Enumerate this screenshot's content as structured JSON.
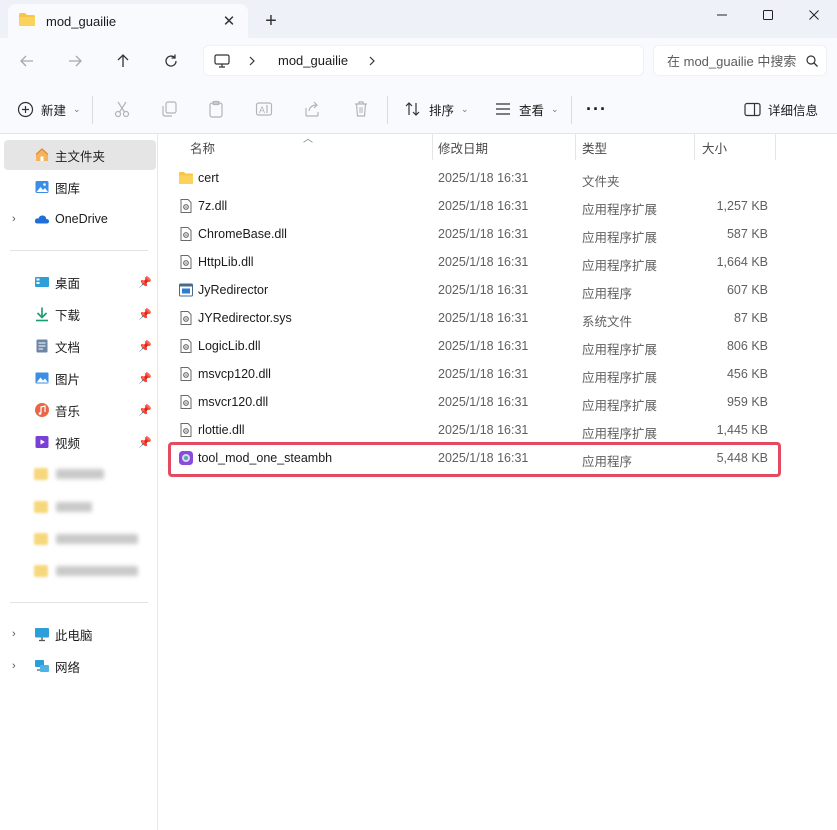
{
  "tab": {
    "title": "mod_guailie",
    "close": "✕",
    "new": "+"
  },
  "window": {
    "minimize": "—",
    "maximize": "☐",
    "close": "✕"
  },
  "address": {
    "path": "mod_guailie",
    "search_placeholder": "在 mod_guailie 中搜索"
  },
  "toolbar": {
    "new_label": "新建",
    "sort_label": "排序",
    "view_label": "查看",
    "more_label": "···",
    "details_label": "详细信息"
  },
  "sidebar": {
    "home": "主文件夹",
    "gallery": "图库",
    "onedrive": "OneDrive",
    "desktop": "桌面",
    "downloads": "下载",
    "documents": "文档",
    "pictures": "图片",
    "music": "音乐",
    "videos": "视频",
    "thispc": "此电脑",
    "network": "网络"
  },
  "columns": {
    "name": "名称",
    "date": "修改日期",
    "type": "类型",
    "size": "大小"
  },
  "files": [
    {
      "name": "cert",
      "date": "2025/1/18 16:31",
      "type": "文件夹",
      "size": "",
      "icon": "folder-icon"
    },
    {
      "name": "7z.dll",
      "date": "2025/1/18 16:31",
      "type": "应用程序扩展",
      "size": "1,257 KB",
      "icon": "dll-icon"
    },
    {
      "name": "ChromeBase.dll",
      "date": "2025/1/18 16:31",
      "type": "应用程序扩展",
      "size": "587 KB",
      "icon": "dll-icon"
    },
    {
      "name": "HttpLib.dll",
      "date": "2025/1/18 16:31",
      "type": "应用程序扩展",
      "size": "1,664 KB",
      "icon": "dll-icon"
    },
    {
      "name": "JyRedirector",
      "date": "2025/1/18 16:31",
      "type": "应用程序",
      "size": "607 KB",
      "icon": "exe-icon"
    },
    {
      "name": "JYRedirector.sys",
      "date": "2025/1/18 16:31",
      "type": "系统文件",
      "size": "87 KB",
      "icon": "sys-icon"
    },
    {
      "name": "LogicLib.dll",
      "date": "2025/1/18 16:31",
      "type": "应用程序扩展",
      "size": "806 KB",
      "icon": "dll-icon"
    },
    {
      "name": "msvcp120.dll",
      "date": "2025/1/18 16:31",
      "type": "应用程序扩展",
      "size": "456 KB",
      "icon": "dll-icon"
    },
    {
      "name": "msvcr120.dll",
      "date": "2025/1/18 16:31",
      "type": "应用程序扩展",
      "size": "959 KB",
      "icon": "dll-icon"
    },
    {
      "name": "rlottie.dll",
      "date": "2025/1/18 16:31",
      "type": "应用程序扩展",
      "size": "1,445 KB",
      "icon": "dll-icon"
    },
    {
      "name": "tool_mod_one_steambh",
      "date": "2025/1/18 16:31",
      "type": "应用程序",
      "size": "5,448 KB",
      "icon": "app-purple-icon"
    }
  ],
  "colors": {
    "highlight": "#e34b60",
    "folder": "#f8c544",
    "selected": "#e5e5e5"
  }
}
